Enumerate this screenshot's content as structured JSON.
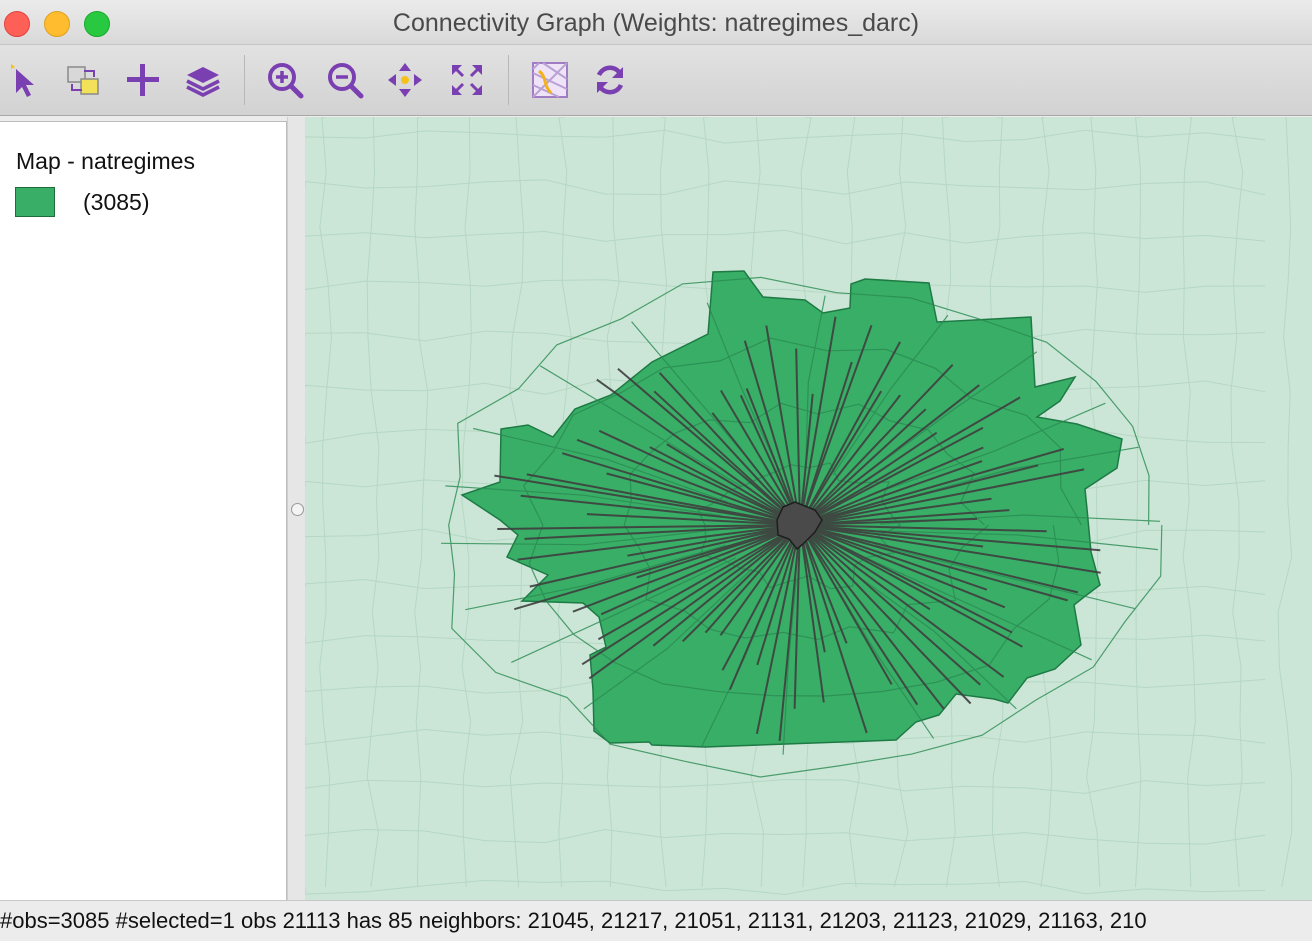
{
  "window": {
    "title": "Connectivity Graph (Weights: natregimes_darc)"
  },
  "toolbar": {
    "buttons": [
      {
        "name": "select-tool",
        "icon": "pointer-arrow-icon"
      },
      {
        "name": "selection-shape",
        "icon": "select-shape-icon"
      },
      {
        "name": "add-layer",
        "icon": "plus-icon"
      },
      {
        "name": "layers",
        "icon": "layers-icon"
      },
      {
        "name": "zoom-in",
        "icon": "zoom-in-icon"
      },
      {
        "name": "zoom-out",
        "icon": "zoom-out-icon"
      },
      {
        "name": "pan",
        "icon": "pan-arrows-icon"
      },
      {
        "name": "full-extent",
        "icon": "full-extent-icon"
      },
      {
        "name": "basemap",
        "icon": "basemap-icon"
      },
      {
        "name": "refresh",
        "icon": "refresh-icon"
      }
    ],
    "icon_color": "#7a3fb0"
  },
  "legend": {
    "title": "Map - natregimes",
    "items": [
      {
        "label": "(3085)",
        "color": "#38ae67"
      }
    ]
  },
  "map": {
    "background_color": "#cbe6d6",
    "selected_fill": "#38ae67",
    "edge_color": "#3f3f3f"
  },
  "status": {
    "text": "#obs=3085 #selected=1  obs 21113 has 85 neighbors: 21045, 21217, 21051, 21131, 21203, 21123, 21029, 21163, 210"
  }
}
